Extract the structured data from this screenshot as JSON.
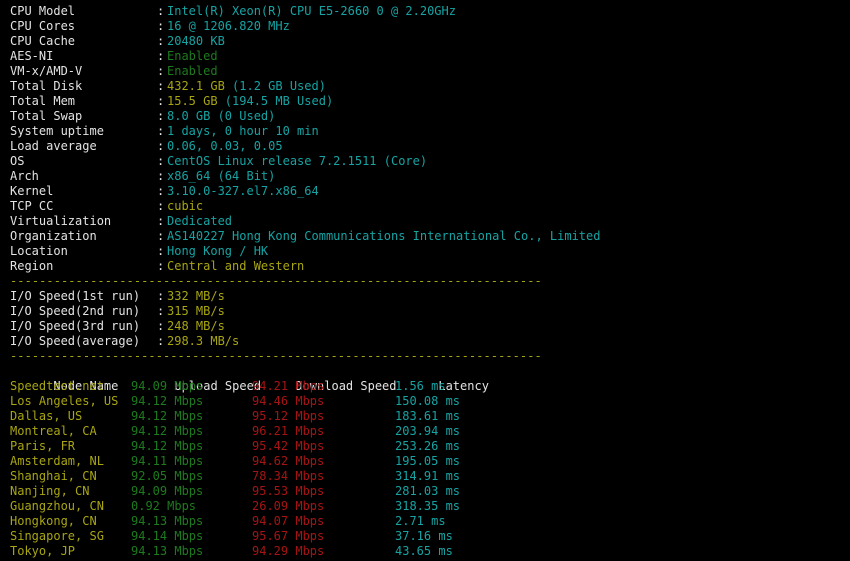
{
  "terminal": {
    "background": "#000000",
    "colors": {
      "label": "#e3e3e3",
      "cyan": "#17a3a3",
      "yellow": "#a8a513",
      "green": "#1e7a1e",
      "red": "#a51414",
      "white": "#e3e3e3"
    }
  },
  "sysinfo": {
    "rows": [
      {
        "label": "CPU Model",
        "sep": ":",
        "value": "Intel(R) Xeon(R) CPU E5-2660 0 @ 2.20GHz",
        "color": "cyan"
      },
      {
        "label": "CPU Cores",
        "sep": ":",
        "value": "16 @ 1206.820 MHz",
        "color": "cyan"
      },
      {
        "label": "CPU Cache",
        "sep": ":",
        "value": "20480 KB",
        "color": "cyan"
      },
      {
        "label": "AES-NI",
        "sep": ":",
        "value": "Enabled",
        "color": "green"
      },
      {
        "label": "VM-x/AMD-V",
        "sep": ":",
        "value": "Enabled",
        "color": "green"
      },
      {
        "label": "Total Disk",
        "sep": ":",
        "value": "432.1 GB",
        "value2": " (1.2 GB Used)",
        "color": "yellow",
        "color2": "cyan"
      },
      {
        "label": "Total Mem",
        "sep": ":",
        "value": "15.5 GB",
        "value2": " (194.5 MB Used)",
        "color": "yellow",
        "color2": "cyan"
      },
      {
        "label": "Total Swap",
        "sep": ":",
        "value": "8.0 GB (0 Used)",
        "color": "cyan"
      },
      {
        "label": "System uptime",
        "sep": ":",
        "value": "1 days, 0 hour 10 min",
        "color": "cyan"
      },
      {
        "label": "Load average",
        "sep": ":",
        "value": "0.06, 0.03, 0.05",
        "color": "cyan"
      },
      {
        "label": "OS",
        "sep": ":",
        "value": "CentOS Linux release 7.2.1511 (Core)",
        "color": "cyan"
      },
      {
        "label": "Arch",
        "sep": ":",
        "value": "x86_64 (64 Bit)",
        "color": "cyan"
      },
      {
        "label": "Kernel",
        "sep": ":",
        "value": "3.10.0-327.el7.x86_64",
        "color": "cyan"
      },
      {
        "label": "TCP CC",
        "sep": ":",
        "value": "cubic",
        "color": "yellow"
      },
      {
        "label": "Virtualization",
        "sep": ":",
        "value": "Dedicated",
        "color": "cyan"
      },
      {
        "label": "Organization",
        "sep": ":",
        "value": "AS140227 Hong Kong Communications International Co., Limited",
        "color": "cyan"
      },
      {
        "label": "Location",
        "sep": ":",
        "value": "Hong Kong / HK",
        "color": "cyan"
      },
      {
        "label": "Region",
        "sep": ":",
        "value": "Central and Western",
        "color": "yellow"
      }
    ]
  },
  "divider": "-------------------------------------------------------------------------",
  "iospeed": {
    "rows": [
      {
        "label": "I/O Speed(1st run)",
        "sep": ":",
        "value": "332 MB/s",
        "color": "yellow"
      },
      {
        "label": "I/O Speed(2nd run)",
        "sep": ":",
        "value": "315 MB/s",
        "color": "yellow"
      },
      {
        "label": "I/O Speed(3rd run)",
        "sep": ":",
        "value": "248 MB/s",
        "color": "yellow"
      },
      {
        "label": "I/O Speed(average)",
        "sep": ":",
        "value": "298.3 MB/s",
        "color": "yellow"
      }
    ]
  },
  "speedtest": {
    "headers": {
      "node": "Node Name",
      "upload": "Upload Speed",
      "download": "Download Speed",
      "latency": "Latency"
    },
    "rows": [
      {
        "node": "Speedtest.net",
        "upload": "94.09 Mbps",
        "download": "94.21 Mbps",
        "latency": "1.56 ms"
      },
      {
        "node": "Los Angeles, US",
        "upload": "94.12 Mbps",
        "download": "94.46 Mbps",
        "latency": "150.08 ms"
      },
      {
        "node": "Dallas, US",
        "upload": "94.12 Mbps",
        "download": "95.12 Mbps",
        "latency": "183.61 ms"
      },
      {
        "node": "Montreal, CA",
        "upload": "94.12 Mbps",
        "download": "96.21 Mbps",
        "latency": "203.94 ms"
      },
      {
        "node": "Paris, FR",
        "upload": "94.12 Mbps",
        "download": "95.42 Mbps",
        "latency": "253.26 ms"
      },
      {
        "node": "Amsterdam, NL",
        "upload": "94.11 Mbps",
        "download": "94.62 Mbps",
        "latency": "195.05 ms"
      },
      {
        "node": "Shanghai, CN",
        "upload": "92.05 Mbps",
        "download": "78.34 Mbps",
        "latency": "314.91 ms"
      },
      {
        "node": "Nanjing, CN",
        "upload": "94.09 Mbps",
        "download": "95.53 Mbps",
        "latency": "281.03 ms"
      },
      {
        "node": "Guangzhou, CN",
        "upload": "0.92 Mbps",
        "download": "26.09 Mbps",
        "latency": "318.35 ms"
      },
      {
        "node": "Hongkong, CN",
        "upload": "94.13 Mbps",
        "download": "94.07 Mbps",
        "latency": "2.71 ms"
      },
      {
        "node": "Singapore, SG",
        "upload": "94.14 Mbps",
        "download": "95.67 Mbps",
        "latency": "37.16 ms"
      },
      {
        "node": "Tokyo, JP",
        "upload": "94.13 Mbps",
        "download": "94.29 Mbps",
        "latency": "43.65 ms"
      }
    ]
  }
}
